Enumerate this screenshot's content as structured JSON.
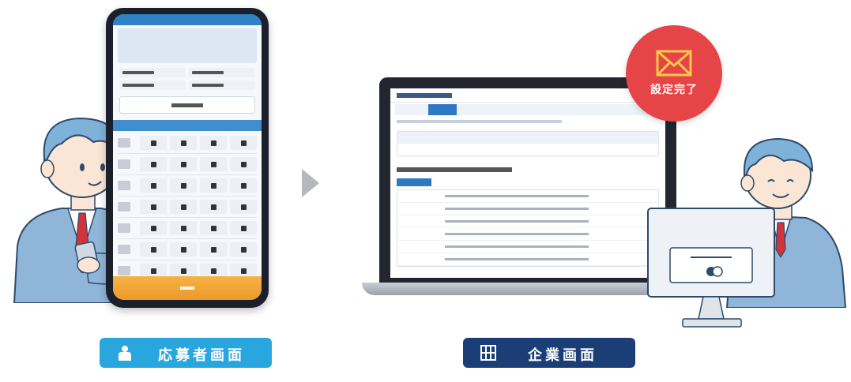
{
  "badge": {
    "label": "設定完了"
  },
  "labels": {
    "applicant": "応募者画面",
    "company": "企業画面"
  },
  "icons": {
    "applicant": "person-icon",
    "company": "building-icon",
    "badge": "envelope-icon",
    "arrow": "triangle-right-icon"
  },
  "colors": {
    "applicant_accent": "#2aa6df",
    "company_accent": "#1c3e77",
    "badge_color": "#e64548"
  }
}
